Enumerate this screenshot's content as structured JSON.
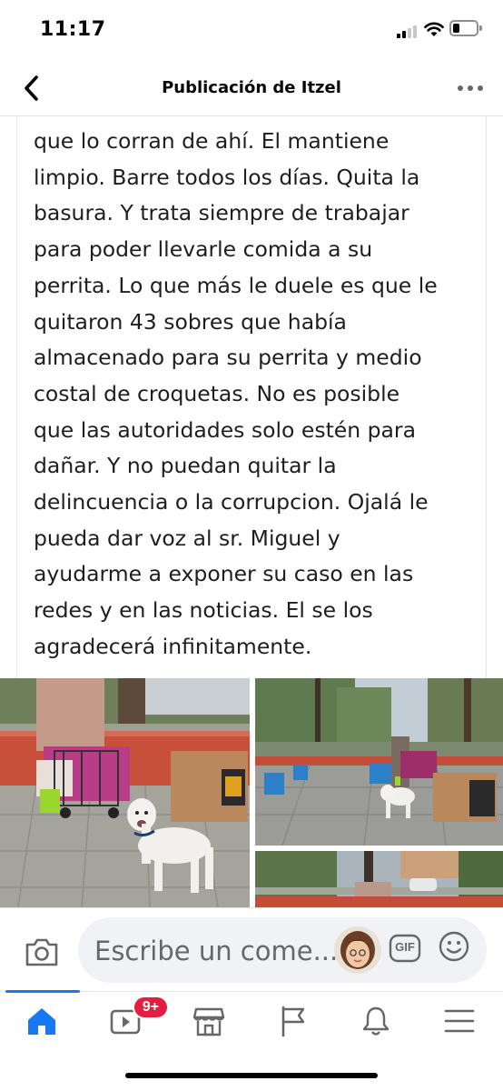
{
  "status_bar": {
    "time": "11:17"
  },
  "header": {
    "title": "Publicación de Itzel",
    "back_icon": "chevron-left-icon",
    "more_icon": "more-dots-icon"
  },
  "post": {
    "lines": [
      "que lo corran de ahí. El mantiene",
      "limpio. Barre todos los días. Quita la",
      "basura. Y trata siempre de trabajar",
      "para poder llevarle comida a su",
      "perrita. Lo que más le duele es que le",
      "quitaron 43 sobres que había",
      "almacenado para su perrita y medio",
      "costal de croquetas. No es posible",
      "que las autoridades solo estén para",
      "dañar. Y no puedan quitar la",
      "delincuencia o la corrupcion. Ojalá  le",
      "pueda dar voz al sr. Miguel  y",
      "ayudarme a exponer su caso en las",
      "redes y en las noticias. El se los",
      "agradecerá infinitamente."
    ]
  },
  "photos": {
    "count": 3
  },
  "comment_bar": {
    "placeholder": "Escribe un come...",
    "gif_label": "GIF",
    "icons": [
      "camera-icon",
      "avatar",
      "gif-icon",
      "emoji-icon"
    ]
  },
  "bottom_nav": {
    "items": [
      {
        "name": "home",
        "icon": "home-icon",
        "active": true
      },
      {
        "name": "watch",
        "icon": "video-icon",
        "badge": "9+"
      },
      {
        "name": "marketplace",
        "icon": "store-icon"
      },
      {
        "name": "pages",
        "icon": "flag-icon"
      },
      {
        "name": "notifications",
        "icon": "bell-icon"
      },
      {
        "name": "menu",
        "icon": "menu-icon"
      }
    ],
    "badge": "9+"
  },
  "colors": {
    "accent": "#1877f2",
    "badge": "#e41e3f",
    "input_bg": "#f0f2f5",
    "secondary_text": "#65676b"
  }
}
